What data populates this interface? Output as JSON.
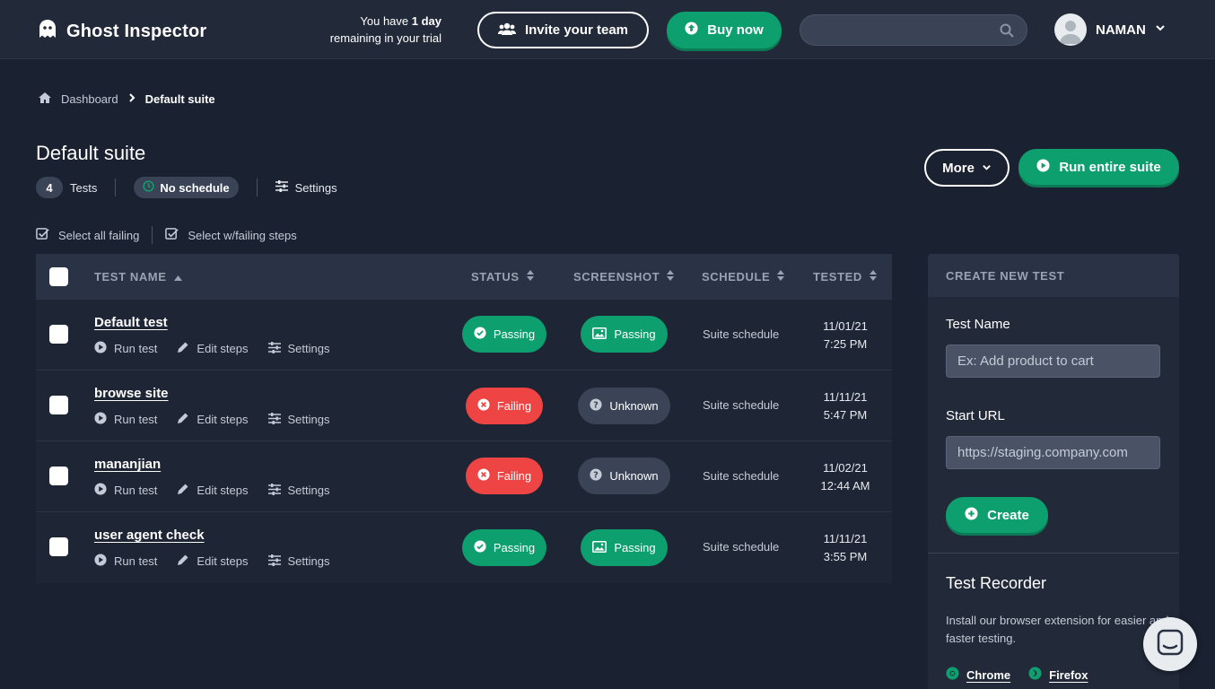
{
  "header": {
    "logo_text": "Ghost Inspector",
    "trial_prefix": "You have ",
    "trial_bold": "1 day",
    "trial_suffix": "remaining in your trial",
    "invite_label": "Invite your team",
    "buy_label": "Buy now",
    "search_placeholder": "",
    "user_name": "NAMAN"
  },
  "breadcrumb": {
    "home": "Dashboard",
    "current": "Default suite"
  },
  "suite": {
    "title": "Default suite",
    "test_count": "4",
    "tests_label": "Tests",
    "schedule_label": "No schedule",
    "settings_label": "Settings",
    "more_label": "More",
    "run_label": "Run entire suite",
    "select_all_failing": "Select all failing",
    "select_failing_steps": "Select w/failing steps"
  },
  "table": {
    "columns": {
      "name": "TEST NAME",
      "status": "STATUS",
      "screenshot": "SCREENSHOT",
      "schedule": "SCHEDULE",
      "tested": "TESTED"
    },
    "action_labels": {
      "run": "Run test",
      "edit": "Edit steps",
      "settings": "Settings"
    },
    "rows": [
      {
        "name": "Default test",
        "status": "Passing",
        "screenshot": "Passing",
        "schedule": "Suite schedule",
        "date": "11/01/21",
        "time": "7:25 PM"
      },
      {
        "name": "browse site",
        "status": "Failing",
        "screenshot": "Unknown",
        "schedule": "Suite schedule",
        "date": "11/11/21",
        "time": "5:47 PM"
      },
      {
        "name": "mananjian",
        "status": "Failing",
        "screenshot": "Unknown",
        "schedule": "Suite schedule",
        "date": "11/02/21",
        "time": "12:44 AM"
      },
      {
        "name": "user agent check",
        "status": "Passing",
        "screenshot": "Passing",
        "schedule": "Suite schedule",
        "date": "11/11/21",
        "time": "3:55 PM"
      }
    ]
  },
  "panel": {
    "header": "CREATE NEW TEST",
    "name_label": "Test Name",
    "name_placeholder": "Ex: Add product to cart",
    "url_label": "Start URL",
    "url_placeholder": "https://staging.company.com",
    "create_label": "Create",
    "recorder_title": "Test Recorder",
    "recorder_desc": "Install our browser extension for easier and faster testing.",
    "chrome_label": "Chrome",
    "firefox_label": "Firefox"
  },
  "colors": {
    "background": "#1a2130",
    "passing": "#0e9f6e",
    "failing": "#ef4444",
    "unknown": "#3a4456"
  }
}
